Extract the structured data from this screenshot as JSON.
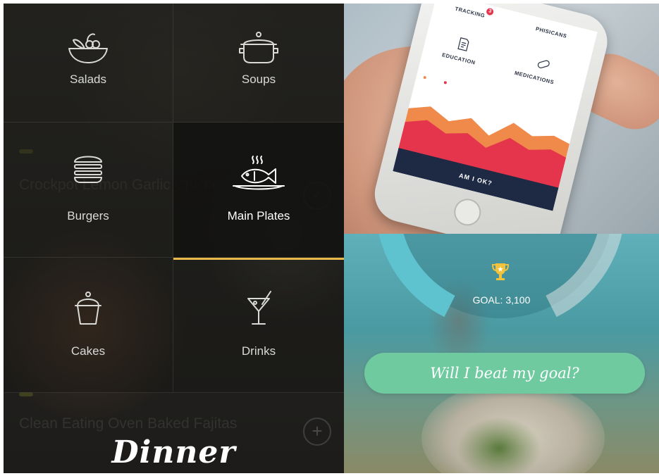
{
  "menu": {
    "categories": [
      {
        "label": "Salads",
        "icon": "salad-bowl-icon",
        "active": false
      },
      {
        "label": "Soups",
        "icon": "soup-pot-icon",
        "active": false
      },
      {
        "label": "Burgers",
        "icon": "burger-icon",
        "active": false
      },
      {
        "label": "Main Plates",
        "icon": "fish-plate-icon",
        "active": true
      },
      {
        "label": "Cakes",
        "icon": "cupcake-icon",
        "active": false
      },
      {
        "label": "Drinks",
        "icon": "cocktail-icon",
        "active": false
      }
    ],
    "accent_color": "#e8b84a",
    "background_recipes": [
      {
        "title": "Crockpot Lemon Garlic Chicken",
        "tag": "",
        "meta": ""
      },
      {
        "title": "Clean Eating Oven Baked Fajitas",
        "tag": "",
        "meta": ""
      }
    ],
    "footer_title": "Dinner"
  },
  "phone_app": {
    "labels": {
      "tracking": "TRACKING",
      "physicians": "PHISICANS",
      "education": "EDUCATION",
      "medications": "MEDICATIONS"
    },
    "tracking_badge": "3",
    "cta": "AM I OK?",
    "chart_colors": {
      "series_a": "#f08a4b",
      "series_b": "#e5354d"
    },
    "cta_color": "#1e2a44"
  },
  "goal_tracker": {
    "goal_text": "GOAL: 3,100",
    "button_label": "Will I beat my goal?",
    "progress_color": "#5ec3cf",
    "button_color": "#6fcb9f"
  }
}
